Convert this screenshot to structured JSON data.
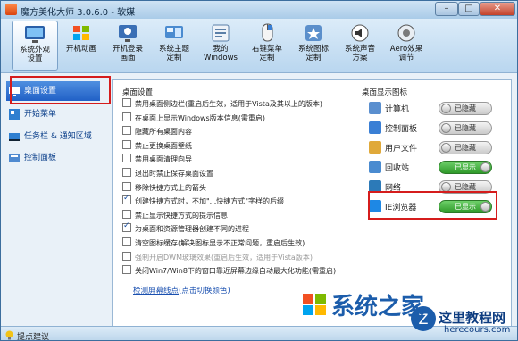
{
  "window": {
    "title": "魔方美化大师 3.0.6.0 - 软媒",
    "min": "–",
    "max": "□",
    "close": "✕"
  },
  "toolbar": [
    {
      "label": "系统外观\n设置"
    },
    {
      "label": "开机动画"
    },
    {
      "label": "开机登录\n画面"
    },
    {
      "label": "系统主题\n定制"
    },
    {
      "label": "我的\nWindows"
    },
    {
      "label": "右键菜单\n定制"
    },
    {
      "label": "系统图标\n定制"
    },
    {
      "label": "系统声音\n方案"
    },
    {
      "label": "Aero效果\n调节"
    }
  ],
  "sidebar": [
    {
      "label": "桌面设置"
    },
    {
      "label": "开始菜单"
    },
    {
      "label": "任务栏 & 通知区域"
    },
    {
      "label": "控制面板"
    }
  ],
  "desktop_settings": {
    "title": "桌面设置",
    "options": [
      {
        "label": "禁用桌面侧边栏(重启后生效，适用于Vista及其以上的版本)",
        "checked": false
      },
      {
        "label": "在桌面上显示Windows版本信息(需重启)",
        "checked": false
      },
      {
        "label": "隐藏所有桌面内容",
        "checked": false
      },
      {
        "label": "禁止更换桌面壁纸",
        "checked": false
      },
      {
        "label": "禁用桌面清理向导",
        "checked": false
      },
      {
        "label": "退出时禁止保存桌面设置",
        "checked": false
      },
      {
        "label": "移除快捷方式上的箭头",
        "checked": false
      },
      {
        "label": "创建快捷方式时，不加\"...快捷方式\"字样的后缀",
        "checked": true
      },
      {
        "label": "禁止显示快捷方式的提示信息",
        "checked": false
      },
      {
        "label": "为桌面和资源管理器创建不同的进程",
        "checked": true
      },
      {
        "label": "清空图标缓存(解决图标显示不正常问题，重启后生效)",
        "checked": false
      },
      {
        "label": "强制开启DWM玻璃效果(重启后生效，适用于Vista版本)",
        "checked": false,
        "disabled": true
      },
      {
        "label": "关闭Win7/Win8下的窗口靠近屏幕边缘自动最大化功能(需重启)",
        "checked": false
      }
    ],
    "link": "检测屏幕线点",
    "link_suffix": "(点击切换颜色)"
  },
  "desktop_icons": {
    "title": "桌面显示图标",
    "items": [
      {
        "label": "计算机",
        "state": "已隐藏",
        "on": false
      },
      {
        "label": "控制面板",
        "state": "已隐藏",
        "on": false
      },
      {
        "label": "用户文件",
        "state": "已隐藏",
        "on": false
      },
      {
        "label": "回收站",
        "state": "已显示",
        "on": true
      },
      {
        "label": "网络",
        "state": "已隐藏",
        "on": false
      },
      {
        "label": "IE浏览器",
        "state": "已显示",
        "on": true
      }
    ]
  },
  "status": {
    "text": "提点建议"
  },
  "watermark": {
    "brand": "系统之家",
    "site_cn": "这里教程网",
    "site_en": "herecours.com"
  },
  "colors": {
    "highlight": "#d51c1c",
    "toggle_on": "#2f9a2a",
    "accent": "#2160c6"
  }
}
